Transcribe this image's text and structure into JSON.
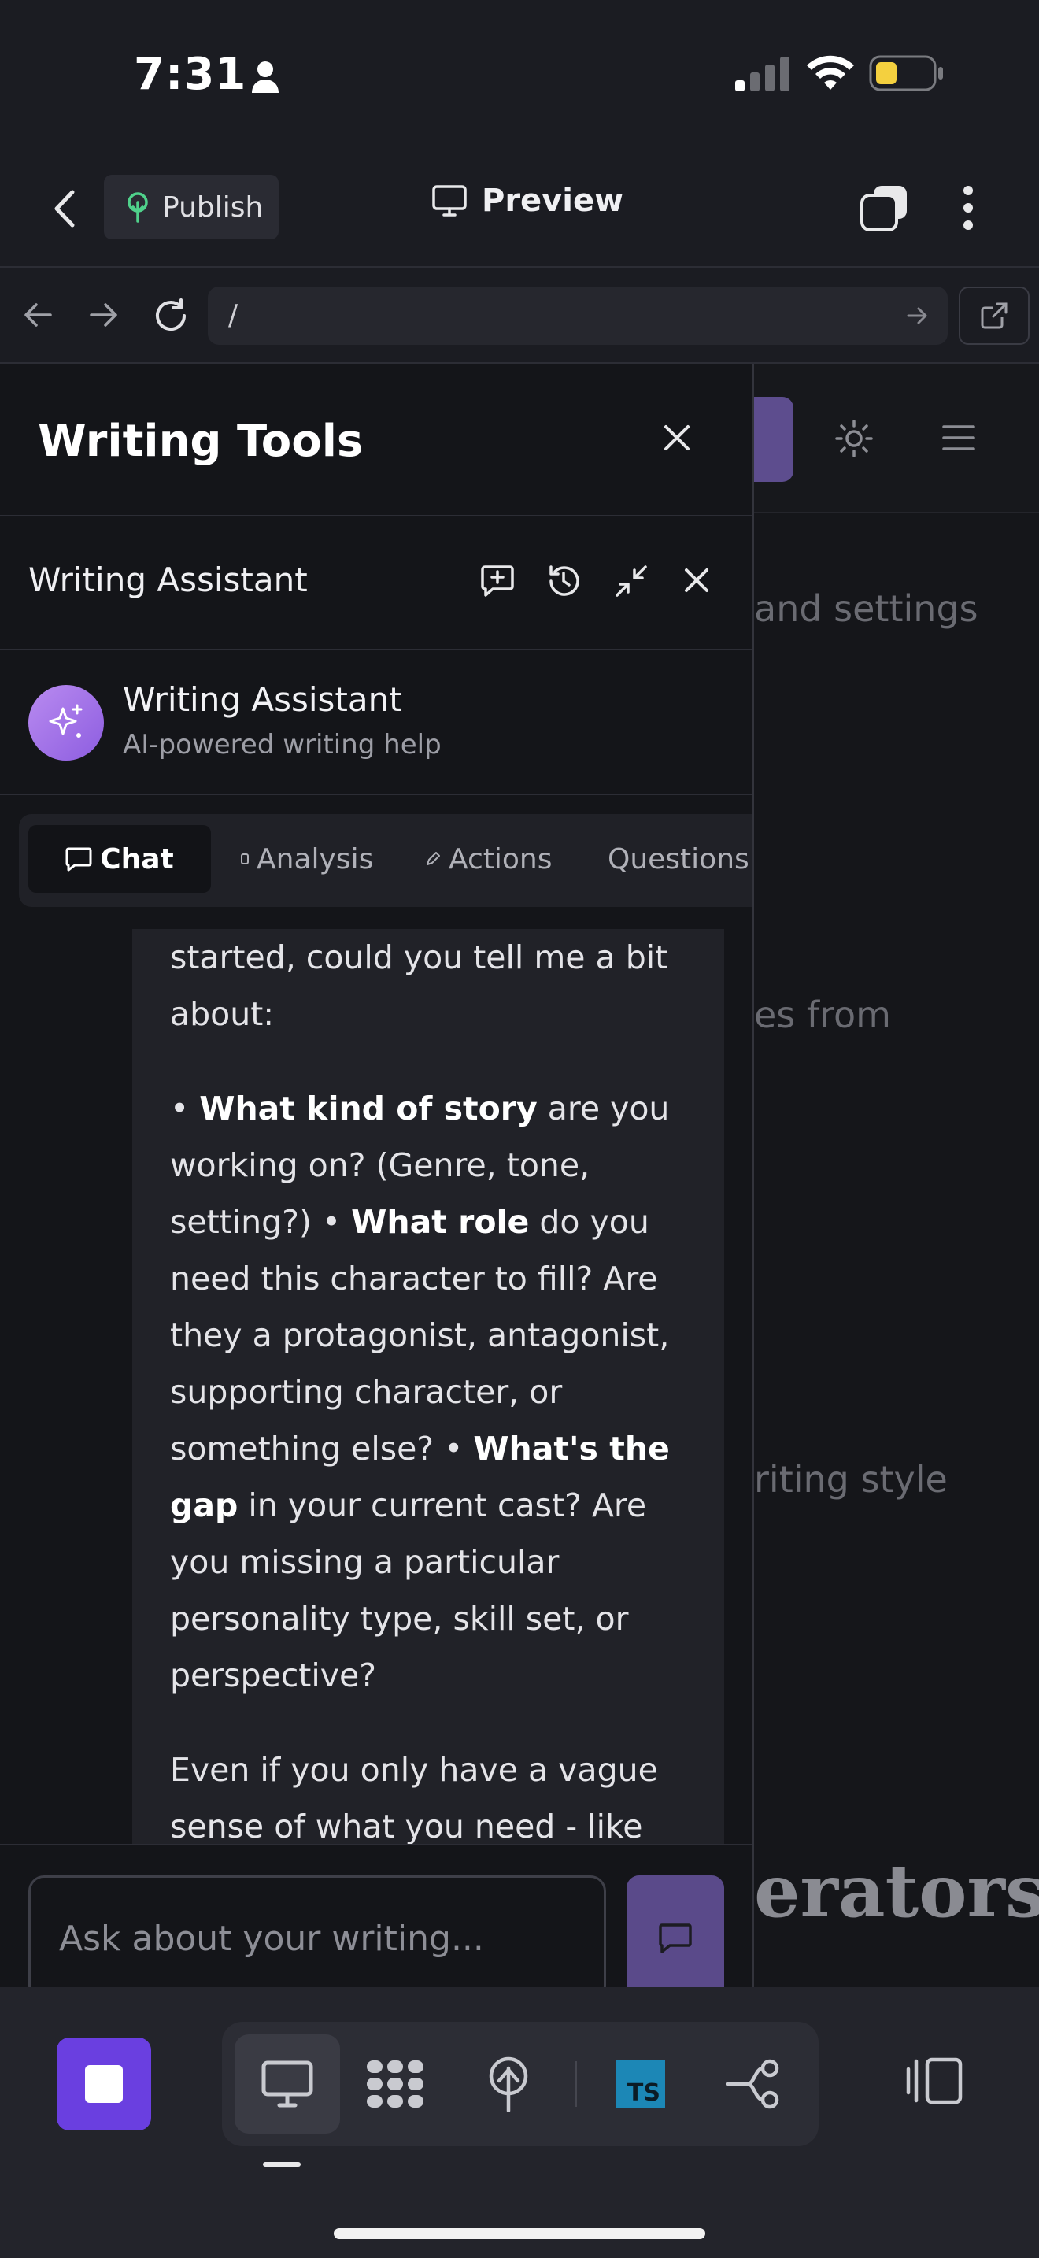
{
  "status_bar": {
    "time": "7:31"
  },
  "top_nav": {
    "publish_label": "Publish",
    "preview_label": "Preview"
  },
  "url_bar": {
    "path": "/"
  },
  "background_app": {
    "snippets": [
      "and settings",
      "es from",
      "riting style",
      "erators"
    ]
  },
  "panel": {
    "title": "Writing Tools",
    "assistant_header": "Writing Assistant",
    "profile": {
      "name": "Writing Assistant",
      "subtitle": "AI-powered writing help"
    },
    "tabs": [
      {
        "label": "Chat",
        "active": true
      },
      {
        "label": "Analysis",
        "active": false
      },
      {
        "label": "Actions",
        "active": false
      },
      {
        "label": "Questions",
        "active": false
      }
    ],
    "message": {
      "intro": "started, could you tell me a bit about:",
      "b1_bold": "What kind of story",
      "b1_rest": " are you working on? (Genre, tone, setting?) • ",
      "b2_bold": "What role",
      "b2_rest": " do you need this character to fill? Are they a protagonist, antagonist, supporting character, or something else? • ",
      "b3_bold": "What's the gap",
      "b3_rest": " in your current cast? Are you missing a particular personality type, skill set, or perspective?",
      "closing": "Even if you only have a vague sense of what you need - like \"someone who creates conflict\""
    },
    "input_placeholder": "Ask about your writing..."
  },
  "bottom_bar": {
    "ts_label": "TS"
  },
  "colors": {
    "accent": "#6a3fe0",
    "panel_bg": "#141519",
    "avatar": "#a070e8",
    "ts_badge": "#1c87b6"
  }
}
